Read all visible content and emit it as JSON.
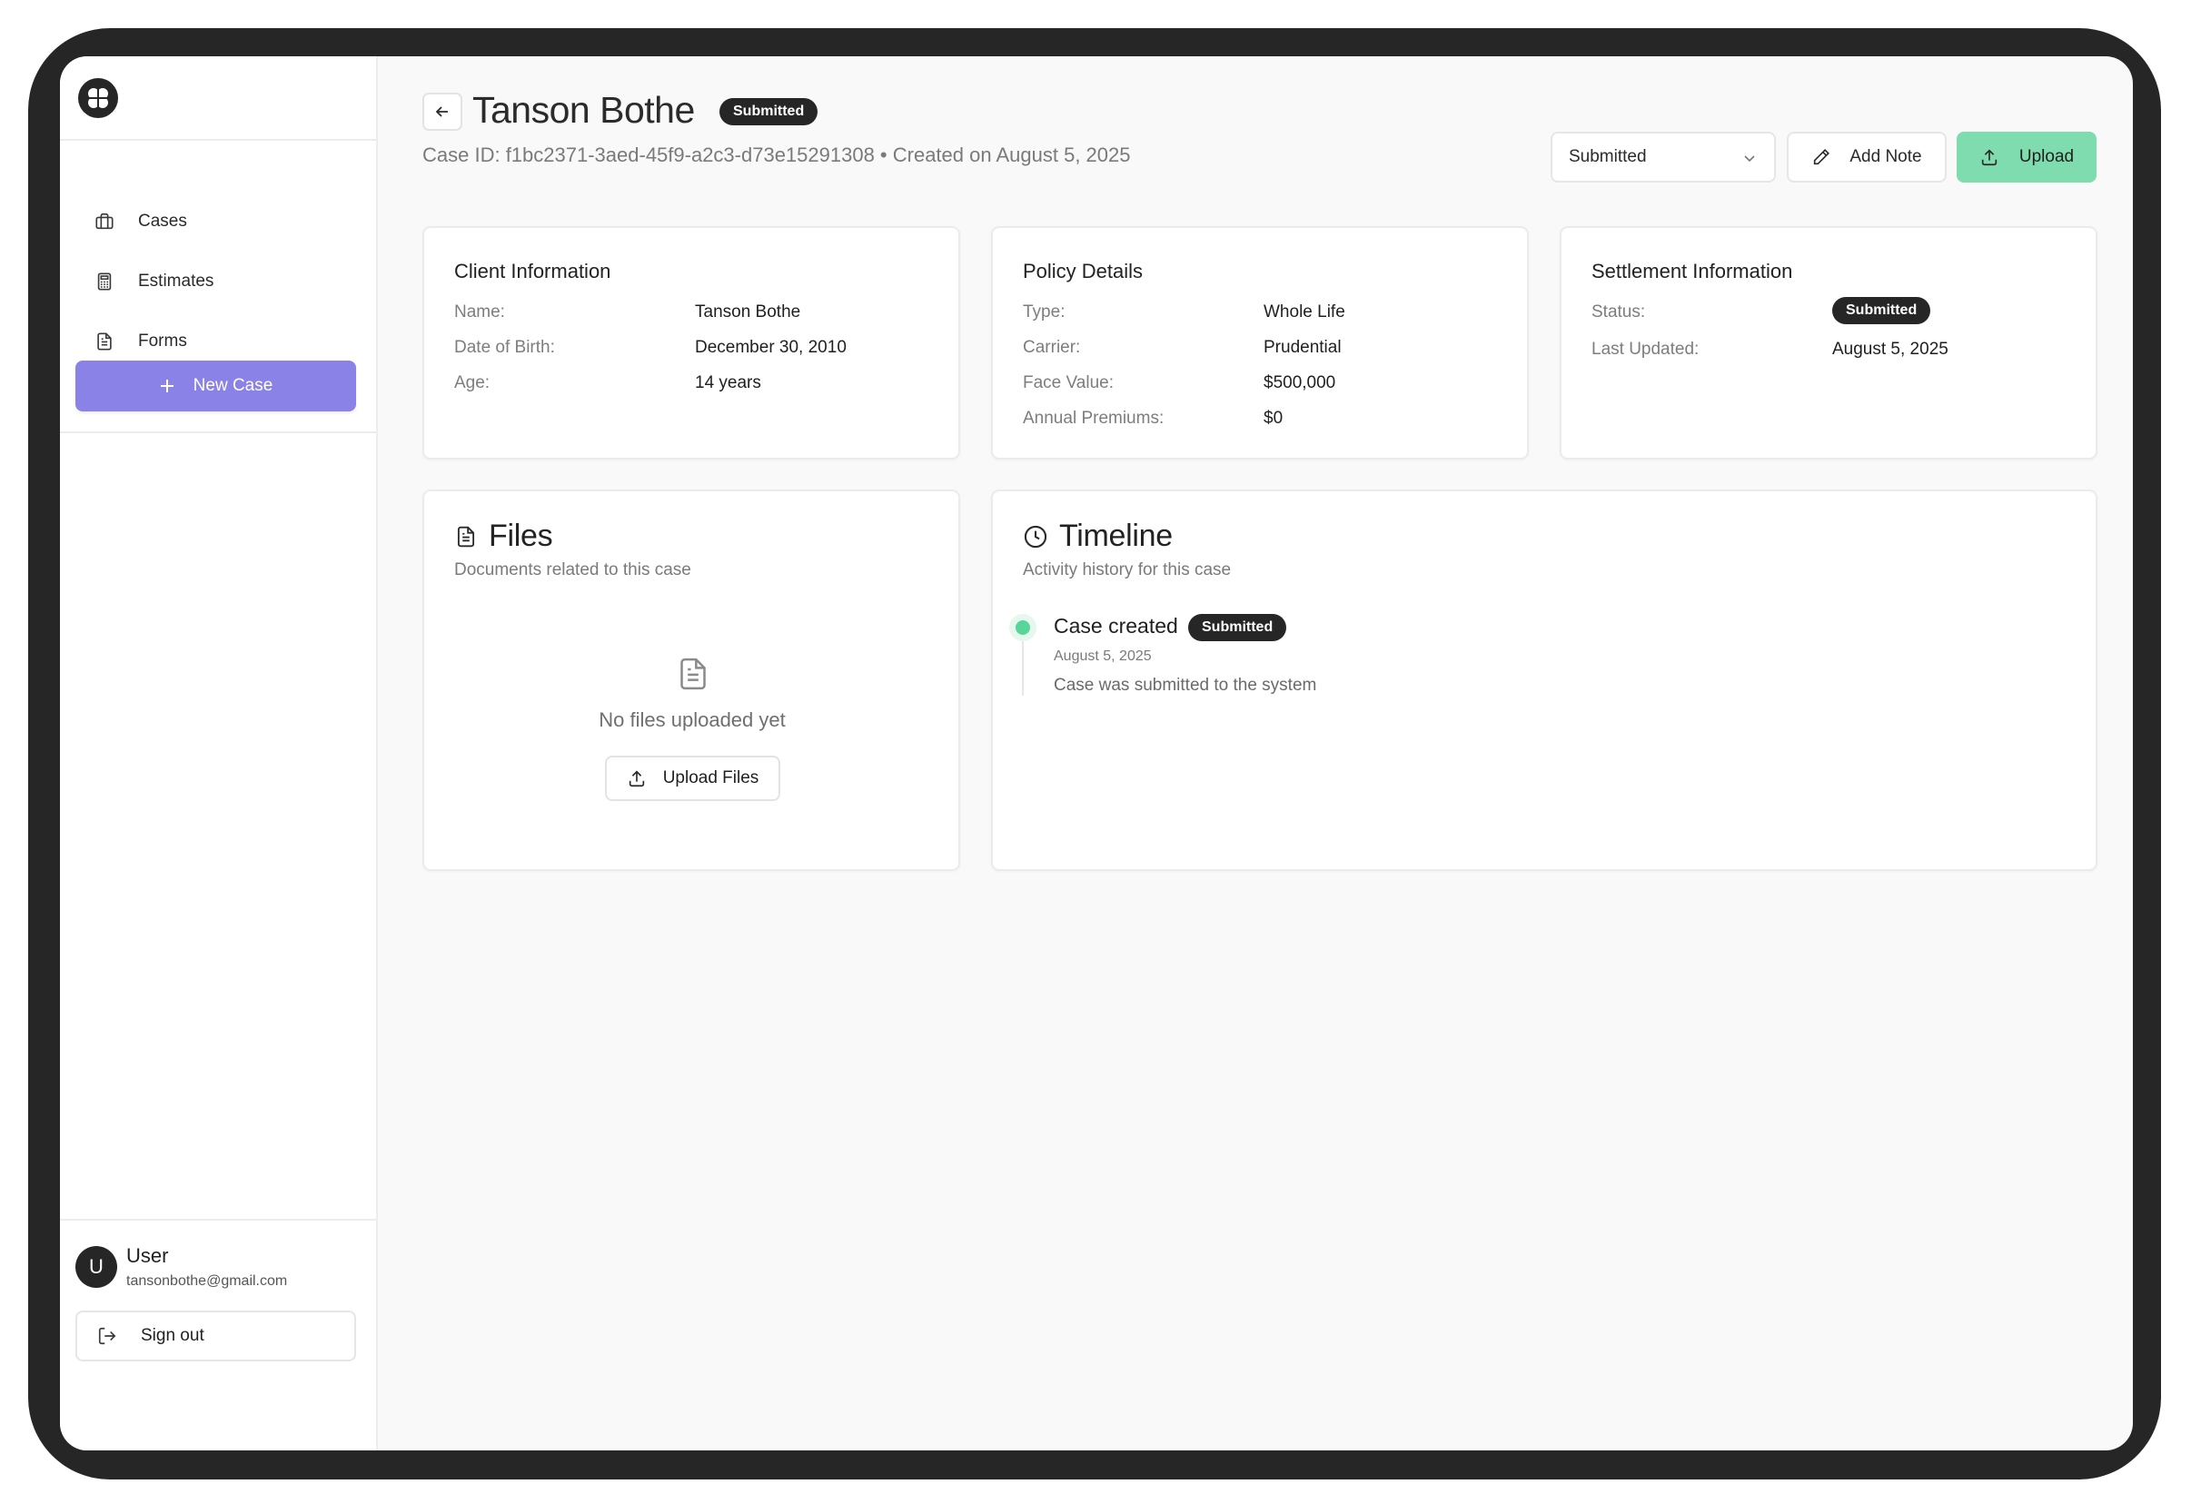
{
  "sidebar": {
    "logo_icon": "clover-logo-icon",
    "nav": [
      {
        "label": "Cases",
        "icon": "briefcase-icon"
      },
      {
        "label": "Estimates",
        "icon": "calculator-icon"
      },
      {
        "label": "Forms",
        "icon": "document-icon"
      }
    ],
    "new_case_label": "New Case",
    "user": {
      "initial": "U",
      "name": "User",
      "email": "tansonbothe@gmail.com"
    },
    "sign_out_label": "Sign out"
  },
  "header": {
    "title": "Tanson Bothe",
    "status_badge": "Submitted",
    "case_id_line": "Case ID: f1bc2371-3aed-45f9-a2c3-d73e15291308 • Created on August 5, 2025",
    "status_select_value": "Submitted",
    "add_note_label": "Add Note",
    "upload_label": "Upload"
  },
  "client_info": {
    "title": "Client Information",
    "rows": [
      {
        "label": "Name:",
        "value": "Tanson Bothe"
      },
      {
        "label": "Date of Birth:",
        "value": "December 30, 2010"
      },
      {
        "label": "Age:",
        "value": "14 years"
      }
    ]
  },
  "policy_details": {
    "title": "Policy Details",
    "rows": [
      {
        "label": "Type:",
        "value": "Whole Life"
      },
      {
        "label": "Carrier:",
        "value": "Prudential"
      },
      {
        "label": "Face Value:",
        "value": "$500,000"
      },
      {
        "label": "Annual Premiums:",
        "value": "$0"
      }
    ]
  },
  "settlement": {
    "title": "Settlement Information",
    "status_label": "Status:",
    "status_value": "Submitted",
    "updated_label": "Last Updated:",
    "updated_value": "August 5, 2025"
  },
  "files": {
    "title": "Files",
    "subtitle": "Documents related to this case",
    "empty_text": "No files uploaded yet",
    "upload_files_label": "Upload Files"
  },
  "timeline": {
    "title": "Timeline",
    "subtitle": "Activity history for this case",
    "events": [
      {
        "title": "Case created",
        "badge": "Submitted",
        "date": "August 5, 2025",
        "description": "Case was submitted to the system"
      }
    ]
  },
  "colors": {
    "brand_purple": "#8a82e6",
    "upload_green": "#7fdcae",
    "timeline_dot": "#58d699",
    "badge_dark": "#262626"
  }
}
